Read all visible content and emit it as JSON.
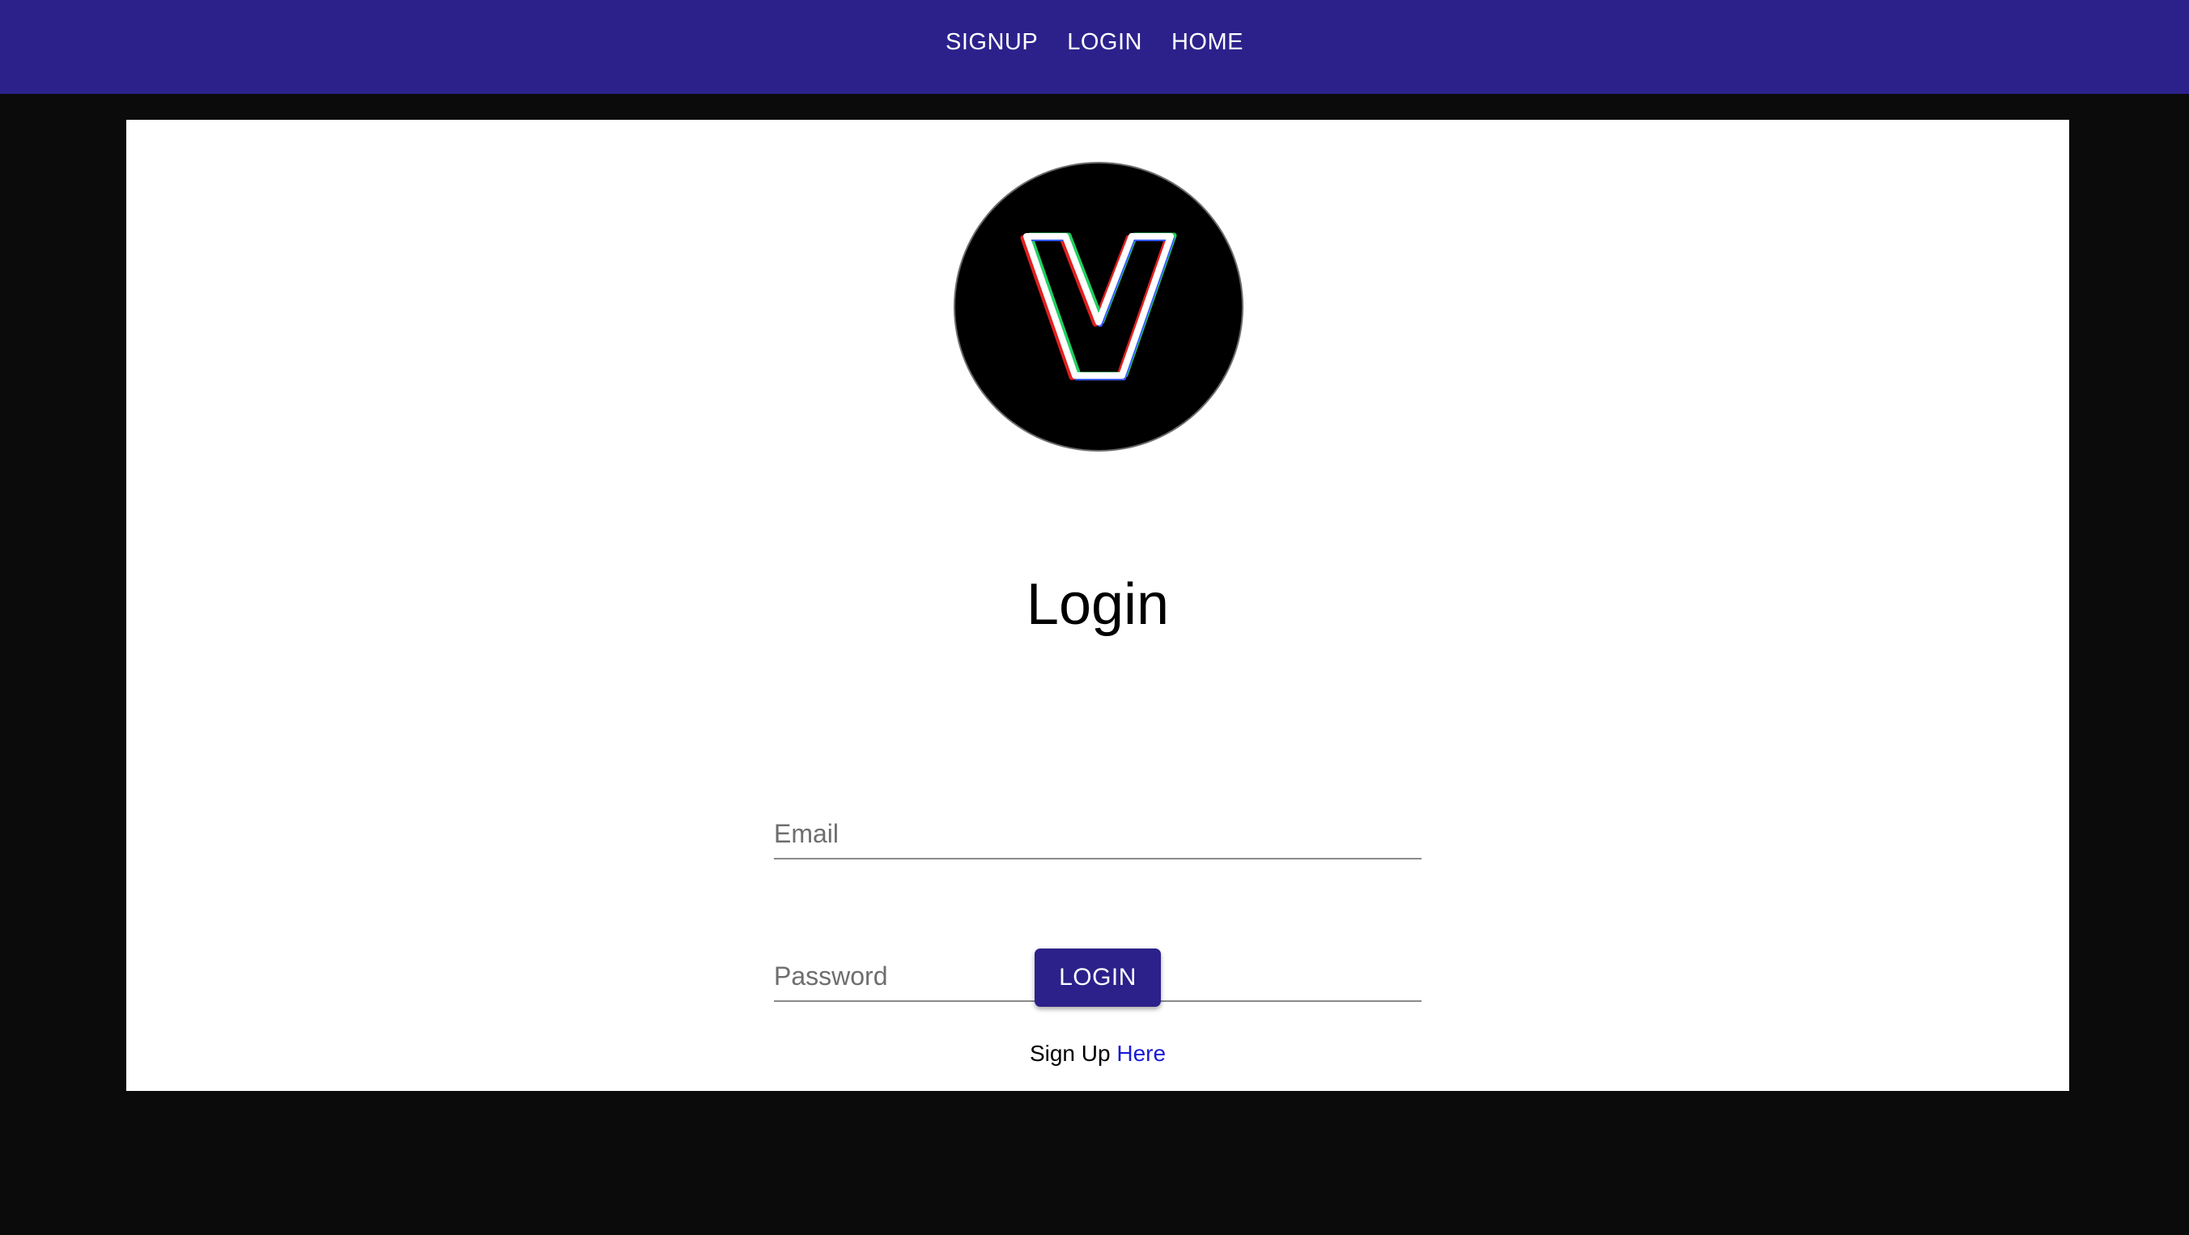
{
  "nav": {
    "items": [
      {
        "label": "SIGNUP"
      },
      {
        "label": "LOGIN"
      },
      {
        "label": "HOME"
      }
    ]
  },
  "logo": {
    "letter": "V",
    "icon": "v-logo-icon"
  },
  "form": {
    "title": "Login",
    "email_placeholder": "Email",
    "password_placeholder": "Password",
    "submit_label": "LOGIN",
    "signup_text": "Sign Up",
    "signup_link": "Here"
  },
  "colors": {
    "brand": "#2c218b",
    "background": "#0b0b0b",
    "card": "#ffffff",
    "link": "#1a1ad6"
  }
}
